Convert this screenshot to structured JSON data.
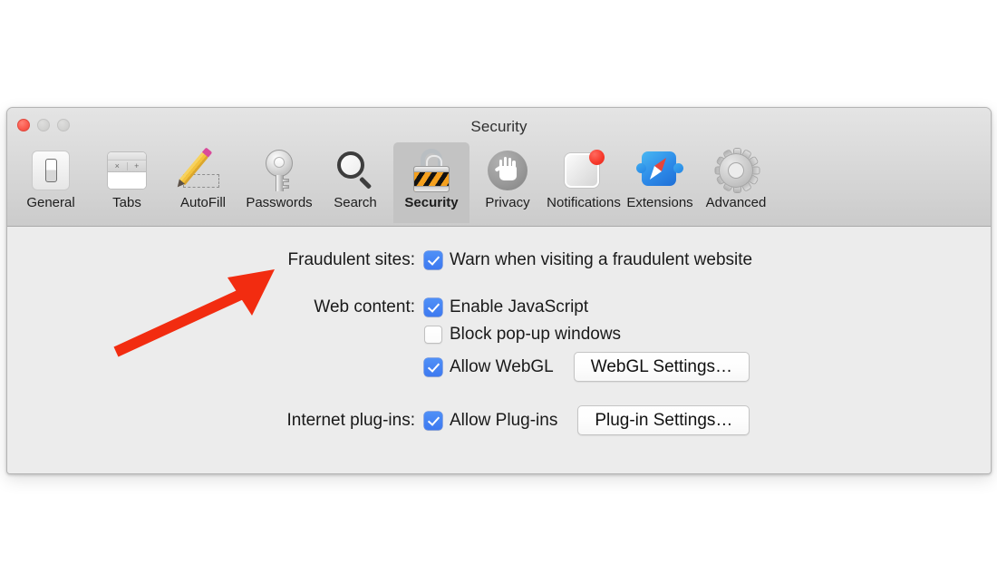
{
  "window": {
    "title": "Security",
    "traffic_lights": [
      {
        "name": "close",
        "color": "#fb5b4f",
        "enabled": true
      },
      {
        "name": "minimize",
        "color": "#d2d2d1",
        "enabled": false
      },
      {
        "name": "zoom",
        "color": "#d2d2d1",
        "enabled": false
      }
    ]
  },
  "toolbar": {
    "selected": "Security",
    "tabs": [
      {
        "label": "General",
        "icon": "switch-icon",
        "selected": false
      },
      {
        "label": "Tabs",
        "icon": "tabs-window-icon",
        "selected": false
      },
      {
        "label": "AutoFill",
        "icon": "pencil-form-icon",
        "selected": false
      },
      {
        "label": "Passwords",
        "icon": "key-icon",
        "selected": false
      },
      {
        "label": "Search",
        "icon": "magnifier-icon",
        "selected": false
      },
      {
        "label": "Security",
        "icon": "padlock-icon",
        "selected": true
      },
      {
        "label": "Privacy",
        "icon": "hand-icon",
        "selected": false
      },
      {
        "label": "Notifications",
        "icon": "notification-badge-icon",
        "selected": false
      },
      {
        "label": "Extensions",
        "icon": "puzzle-compass-icon",
        "selected": false
      },
      {
        "label": "Advanced",
        "icon": "gear-icon",
        "selected": false
      }
    ]
  },
  "tab_icons": {
    "tabs_close_glyph": "×",
    "tabs_new_glyph": "+"
  },
  "settings": {
    "groups": [
      {
        "label": "Fraudulent sites:",
        "rows": [
          {
            "checkbox_label": "Warn when visiting a fraudulent website",
            "checked": true,
            "button": null
          }
        ]
      },
      {
        "label": "Web content:",
        "rows": [
          {
            "checkbox_label": "Enable JavaScript",
            "checked": true,
            "button": null
          },
          {
            "checkbox_label": "Block pop-up windows",
            "checked": false,
            "button": null
          },
          {
            "checkbox_label": "Allow WebGL",
            "checked": true,
            "button": "WebGL Settings…"
          }
        ]
      },
      {
        "label": "Internet plug-ins:",
        "rows": [
          {
            "checkbox_label": "Allow Plug-ins",
            "checked": true,
            "button": "Plug-in Settings…"
          }
        ]
      }
    ]
  },
  "annotation": {
    "arrow": {
      "name": "red-arrow-pointing-to-fraudulent-sites",
      "color": "#f22c10",
      "points_to": "Fraudulent sites:"
    }
  },
  "colors": {
    "window_background": "#ececec",
    "toolbar_top": "#e4e4e4",
    "toolbar_bottom": "#cbcbcb",
    "selected_tab": "#c3c3c3",
    "checkbox_checked": "#3d79f0",
    "lock_orange": "#f4a01e",
    "annotation_red": "#f22c10",
    "text": "#1a1a1a"
  }
}
